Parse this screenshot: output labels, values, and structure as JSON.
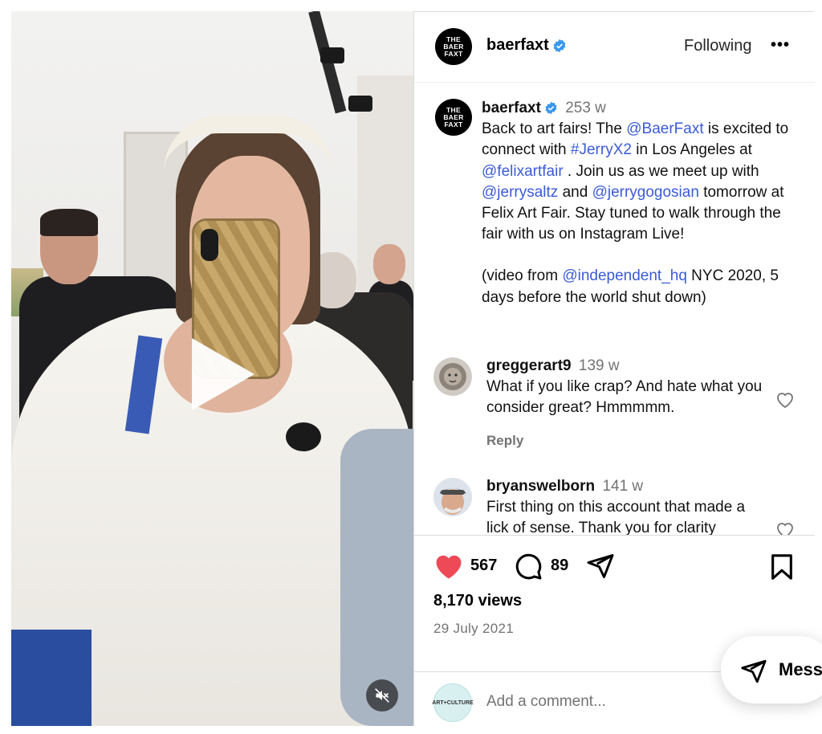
{
  "post": {
    "username": "baerfaxt",
    "follow_status": "Following",
    "more_label": "•••",
    "avatar_lines": [
      "THE",
      "BAER",
      "FAXT"
    ]
  },
  "caption": {
    "username": "baerfaxt",
    "time": "253 w",
    "t1": "Back to art fairs! The ",
    "m1": "@BaerFaxt",
    "t2": " is excited to connect with ",
    "m2": "#JerryX2",
    "t3": " in Los Angeles at ",
    "m3": "@felixartfair",
    "t4": " . Join us as we meet up with ",
    "m4": "@jerrysaltz",
    "t5": " and ",
    "m5": "@jerrygogosian",
    "t6": " tomorrow at Felix Art Fair. Stay tuned to walk through the fair with us on Instagram Live!",
    "t7": "(video from ",
    "m6": "@independent_hq",
    "t8": " NYC 2020, 5 days before the world shut down)"
  },
  "comments": [
    {
      "username": "greggerart9",
      "time": "139 w",
      "text": "What if you like crap? And hate what you consider great? Hmmmmm.",
      "reply": "Reply"
    },
    {
      "username": "bryanswelborn",
      "time": "141 w",
      "text": "First thing on this account that made a lick of sense. Thank you for clarity"
    }
  ],
  "stats": {
    "likes": "567",
    "comments": "89",
    "views": "8,170 views",
    "date": "29 July 2021"
  },
  "composer": {
    "placeholder": "Add a comment...",
    "avatar_text": "ART+CULTURE"
  },
  "messages": {
    "label": "Mess"
  },
  "colors": {
    "like_red": "#ed4956",
    "mention_blue": "#3b5bd6",
    "verified_blue": "#3897f0",
    "meta_gray": "#737373"
  },
  "icons": [
    "play-icon",
    "mute-icon",
    "verified-icon",
    "more-icon",
    "heart-filled-icon",
    "comment-icon",
    "share-icon",
    "save-icon",
    "heart-outline-icon",
    "message-icon"
  ]
}
